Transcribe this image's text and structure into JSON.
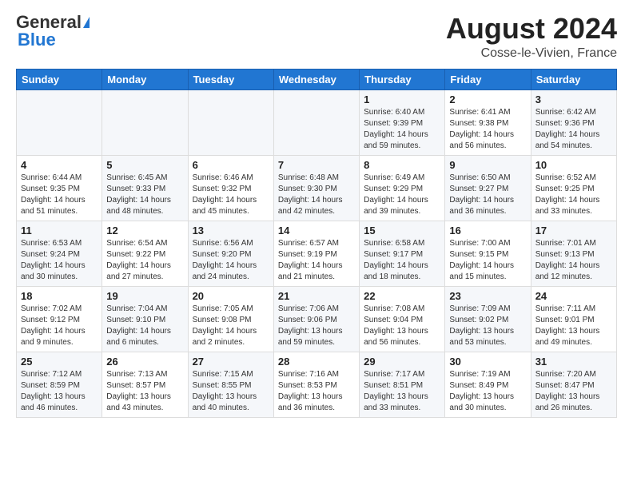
{
  "header": {
    "logo_general": "General",
    "logo_blue": "Blue",
    "month_year": "August 2024",
    "location": "Cosse-le-Vivien, France"
  },
  "weekdays": [
    "Sunday",
    "Monday",
    "Tuesday",
    "Wednesday",
    "Thursday",
    "Friday",
    "Saturday"
  ],
  "weeks": [
    [
      {
        "day": "",
        "info": ""
      },
      {
        "day": "",
        "info": ""
      },
      {
        "day": "",
        "info": ""
      },
      {
        "day": "",
        "info": ""
      },
      {
        "day": "1",
        "info": "Sunrise: 6:40 AM\nSunset: 9:39 PM\nDaylight: 14 hours and 59 minutes."
      },
      {
        "day": "2",
        "info": "Sunrise: 6:41 AM\nSunset: 9:38 PM\nDaylight: 14 hours and 56 minutes."
      },
      {
        "day": "3",
        "info": "Sunrise: 6:42 AM\nSunset: 9:36 PM\nDaylight: 14 hours and 54 minutes."
      }
    ],
    [
      {
        "day": "4",
        "info": "Sunrise: 6:44 AM\nSunset: 9:35 PM\nDaylight: 14 hours and 51 minutes."
      },
      {
        "day": "5",
        "info": "Sunrise: 6:45 AM\nSunset: 9:33 PM\nDaylight: 14 hours and 48 minutes."
      },
      {
        "day": "6",
        "info": "Sunrise: 6:46 AM\nSunset: 9:32 PM\nDaylight: 14 hours and 45 minutes."
      },
      {
        "day": "7",
        "info": "Sunrise: 6:48 AM\nSunset: 9:30 PM\nDaylight: 14 hours and 42 minutes."
      },
      {
        "day": "8",
        "info": "Sunrise: 6:49 AM\nSunset: 9:29 PM\nDaylight: 14 hours and 39 minutes."
      },
      {
        "day": "9",
        "info": "Sunrise: 6:50 AM\nSunset: 9:27 PM\nDaylight: 14 hours and 36 minutes."
      },
      {
        "day": "10",
        "info": "Sunrise: 6:52 AM\nSunset: 9:25 PM\nDaylight: 14 hours and 33 minutes."
      }
    ],
    [
      {
        "day": "11",
        "info": "Sunrise: 6:53 AM\nSunset: 9:24 PM\nDaylight: 14 hours and 30 minutes."
      },
      {
        "day": "12",
        "info": "Sunrise: 6:54 AM\nSunset: 9:22 PM\nDaylight: 14 hours and 27 minutes."
      },
      {
        "day": "13",
        "info": "Sunrise: 6:56 AM\nSunset: 9:20 PM\nDaylight: 14 hours and 24 minutes."
      },
      {
        "day": "14",
        "info": "Sunrise: 6:57 AM\nSunset: 9:19 PM\nDaylight: 14 hours and 21 minutes."
      },
      {
        "day": "15",
        "info": "Sunrise: 6:58 AM\nSunset: 9:17 PM\nDaylight: 14 hours and 18 minutes."
      },
      {
        "day": "16",
        "info": "Sunrise: 7:00 AM\nSunset: 9:15 PM\nDaylight: 14 hours and 15 minutes."
      },
      {
        "day": "17",
        "info": "Sunrise: 7:01 AM\nSunset: 9:13 PM\nDaylight: 14 hours and 12 minutes."
      }
    ],
    [
      {
        "day": "18",
        "info": "Sunrise: 7:02 AM\nSunset: 9:12 PM\nDaylight: 14 hours and 9 minutes."
      },
      {
        "day": "19",
        "info": "Sunrise: 7:04 AM\nSunset: 9:10 PM\nDaylight: 14 hours and 6 minutes."
      },
      {
        "day": "20",
        "info": "Sunrise: 7:05 AM\nSunset: 9:08 PM\nDaylight: 14 hours and 2 minutes."
      },
      {
        "day": "21",
        "info": "Sunrise: 7:06 AM\nSunset: 9:06 PM\nDaylight: 13 hours and 59 minutes."
      },
      {
        "day": "22",
        "info": "Sunrise: 7:08 AM\nSunset: 9:04 PM\nDaylight: 13 hours and 56 minutes."
      },
      {
        "day": "23",
        "info": "Sunrise: 7:09 AM\nSunset: 9:02 PM\nDaylight: 13 hours and 53 minutes."
      },
      {
        "day": "24",
        "info": "Sunrise: 7:11 AM\nSunset: 9:01 PM\nDaylight: 13 hours and 49 minutes."
      }
    ],
    [
      {
        "day": "25",
        "info": "Sunrise: 7:12 AM\nSunset: 8:59 PM\nDaylight: 13 hours and 46 minutes."
      },
      {
        "day": "26",
        "info": "Sunrise: 7:13 AM\nSunset: 8:57 PM\nDaylight: 13 hours and 43 minutes."
      },
      {
        "day": "27",
        "info": "Sunrise: 7:15 AM\nSunset: 8:55 PM\nDaylight: 13 hours and 40 minutes."
      },
      {
        "day": "28",
        "info": "Sunrise: 7:16 AM\nSunset: 8:53 PM\nDaylight: 13 hours and 36 minutes."
      },
      {
        "day": "29",
        "info": "Sunrise: 7:17 AM\nSunset: 8:51 PM\nDaylight: 13 hours and 33 minutes."
      },
      {
        "day": "30",
        "info": "Sunrise: 7:19 AM\nSunset: 8:49 PM\nDaylight: 13 hours and 30 minutes."
      },
      {
        "day": "31",
        "info": "Sunrise: 7:20 AM\nSunset: 8:47 PM\nDaylight: 13 hours and 26 minutes."
      }
    ]
  ]
}
